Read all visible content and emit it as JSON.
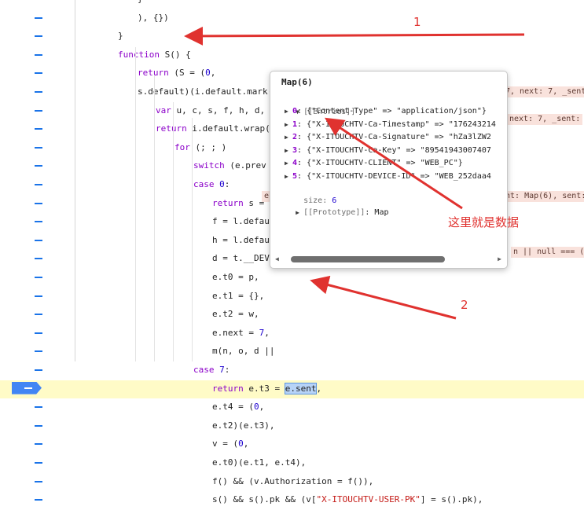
{
  "lines": [
    {
      "indent": 175,
      "html": "}"
    },
    {
      "indent": 175,
      "html": "), {})"
    },
    {
      "indent": 150,
      "html": "}"
    },
    {
      "indent": 150,
      "html": "<span class=\"kw\">function</span> S() {"
    },
    {
      "indent": 175,
      "html": "<span class=\"kw\">return</span> (S = (<span class=\"num\">0</span>,"
    },
    {
      "indent": 175,
      "html": "s.default)(i.default.mark((<span class=\"kw\">function</span> e(n, o, a) {"
    },
    {
      "indent": 198,
      "html": "<span class=\"kw\">var</span> u, c, s, f, h, d, v;"
    },
    {
      "indent": 198,
      "html": "<span class=\"kw\">return</span> i.default.wrap((fu"
    },
    {
      "indent": 222,
      "html": "<span class=\"kw\">for</span> (; ; )"
    },
    {
      "indent": 246,
      "html": "<span class=\"kw\">switch</span> (e.prev ="
    },
    {
      "indent": 246,
      "html": "<span class=\"kw\">case</span> <span class=\"num\">0</span>:"
    },
    {
      "indent": 270,
      "html": "<span class=\"kw\">return</span> s = l."
    },
    {
      "indent": 270,
      "html": "f = l.defaul"
    },
    {
      "indent": 270,
      "html": "h = l.defaul"
    },
    {
      "indent": 270,
      "html": "d = t.__DEVIC"
    },
    {
      "indent": 270,
      "html": "e.t0 = p,"
    },
    {
      "indent": 270,
      "html": "e.t1 = {},"
    },
    {
      "indent": 270,
      "html": "e.t2 = w,"
    },
    {
      "indent": 270,
      "html": "e.next = <span class=\"num\">7</span>,"
    },
    {
      "indent": 270,
      "html": "m(n, o, d ||"
    },
    {
      "indent": 246,
      "html": "<span class=\"kw\">case</span> <span class=\"num\">7</span>:"
    },
    {
      "indent": 270,
      "html": "<span class=\"kw\">return</span> e.t3 = <span class=\"sel\">e.sent</span>,"
    },
    {
      "indent": 270,
      "html": "e.t4 = (<span class=\"num\">0</span>,"
    },
    {
      "indent": 270,
      "html": "e.t2)(e.t3),"
    },
    {
      "indent": 270,
      "html": "v = (<span class=\"num\">0</span>,"
    },
    {
      "indent": 270,
      "html": "e.t0)(e.t1, e.t4),"
    },
    {
      "indent": 270,
      "html": "f() &amp;&amp; (v.Authorization = f()),"
    },
    {
      "indent": 270,
      "html": "s() &amp;&amp; s().pk &amp;&amp; (v[<span class=\"str\">\"X-ITOUCHTV-USER-PK\"</span>] = s().pk),"
    }
  ],
  "inline_values": [
    {
      "text": "7, next: 7, _sent",
      "row": 7
    },
    {
      "text": "next: 7, _sent:",
      "row": 9
    },
    {
      "text": "e",
      "row": 15
    },
    {
      "text": "nt: Map(6), sent:",
      "row": 15
    },
    {
      "text": "n || null === (c",
      "row": 19
    }
  ],
  "popover": {
    "title": "Map(6)",
    "entries_label": "[[Entries]]",
    "entries": [
      {
        "index": "0",
        "text": "{\"Content-Type\" => \"application/json\"}"
      },
      {
        "index": "1",
        "text": "{\"X-ITOUCHTV-Ca-Timestamp\" => \"176243214"
      },
      {
        "index": "2",
        "text": "{\"X-ITOUCHTV-Ca-Signature\" => \"hZa3lZW2"
      },
      {
        "index": "3",
        "text": "{\"X-ITOUCHTV-Ca-Key\" => \"89541943007407"
      },
      {
        "index": "4",
        "text": "{\"X-ITOUCHTV-CLIENT\" => \"WEB_PC\"}"
      },
      {
        "index": "5",
        "text": "{\"X-ITOUCHTV-DEVICE-ID\" => \"WEB_252daa4"
      }
    ],
    "size_label": "size",
    "size_value": "6",
    "prototype_label": "[[Prototype]]",
    "prototype_value": "Map"
  },
  "annotations": {
    "label_1": "1",
    "label_2": "2",
    "data_note": "这里就是数据",
    "color": "#e0322f"
  },
  "highlight_row": 21
}
